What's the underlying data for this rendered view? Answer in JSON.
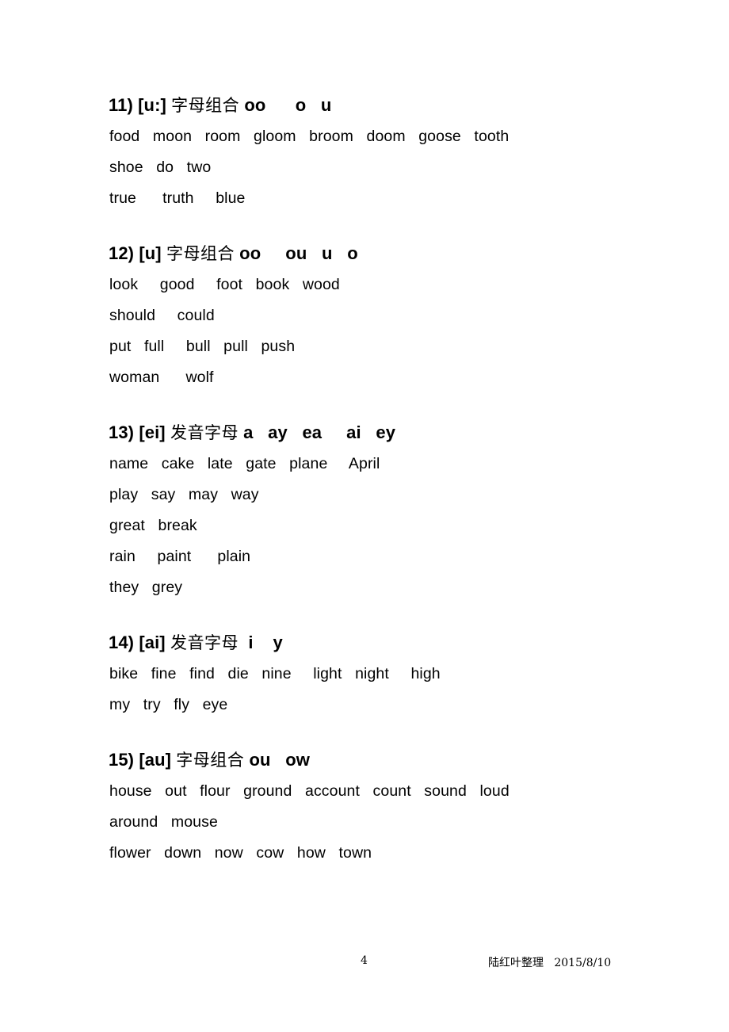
{
  "document": {
    "page_number": "4",
    "footer_credit_cjk": "陆红叶整理",
    "footer_date": "2015/8/10"
  },
  "sections": [
    {
      "number": "11)",
      "phoneme": "[u:]",
      "rule_cjk": "字母组合",
      "letters": "oo      o   u",
      "lines": [
        "food   moon   room   gloom   broom   doom   goose   tooth",
        "shoe   do   two",
        "true      truth     blue"
      ]
    },
    {
      "number": "12)",
      "phoneme": "[u]",
      "rule_cjk": "字母组合",
      "letters": "oo     ou   u   o",
      "lines": [
        "look     good     foot   book   wood",
        "should     could",
        "put   full     bull   pull   push",
        "woman      wolf"
      ]
    },
    {
      "number": "13)",
      "phoneme": "[ei]",
      "rule_cjk": "发音字母",
      "letters": "a   ay   ea     ai   ey",
      "lines": [
        "name   cake   late   gate   plane     April",
        "play   say   may   way",
        "great   break",
        "rain     paint      plain",
        "they   grey"
      ]
    },
    {
      "number": "14)",
      "phoneme": "[ai]",
      "rule_cjk": "发音字母",
      "letters": " i    y",
      "lines": [
        "bike   fine   find   die   nine     light   night     high",
        "my   try   fly   eye"
      ]
    },
    {
      "number": "15)",
      "phoneme": "[au]",
      "rule_cjk": "字母组合",
      "letters": "ou   ow",
      "lines": [
        "house   out   flour   ground   account   count   sound   loud",
        "around   mouse",
        "flower   down   now   cow   how   town"
      ]
    }
  ]
}
